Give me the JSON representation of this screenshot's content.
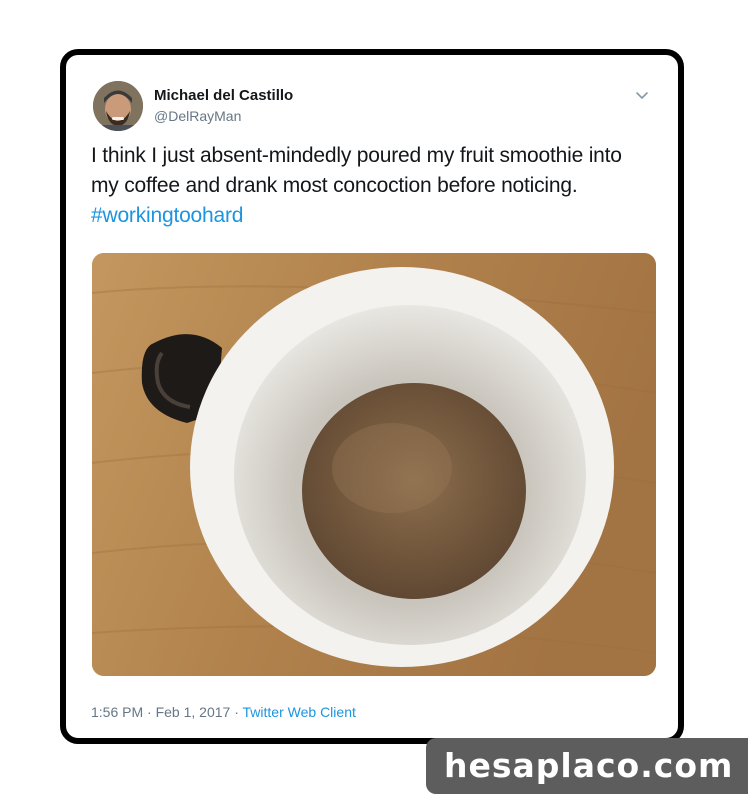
{
  "tweet": {
    "author": {
      "name": "Michael del Castillo",
      "handle": "@DelRayMan",
      "avatar_icon": "profile-avatar"
    },
    "menu_icon": "chevron-down-icon",
    "text": {
      "body": "I think I just absent-mindedly poured my fruit smoothie into my coffee and drank most concoction before noticing. ",
      "hashtag": "#workingtoohard"
    },
    "media": {
      "description_icon": "coffee-mug-photo"
    },
    "meta": {
      "time": "1:56 PM",
      "separator1": " · ",
      "date": "Feb 1, 2017",
      "separator2": " · ",
      "client": "Twitter Web Client"
    }
  },
  "watermark": {
    "text": "hesaplaco.com"
  },
  "colors": {
    "link": "#1b95e0",
    "text": "#14171a",
    "secondary": "#657786",
    "frame": "#000000",
    "watermark_bg": "#5d5d5d"
  }
}
